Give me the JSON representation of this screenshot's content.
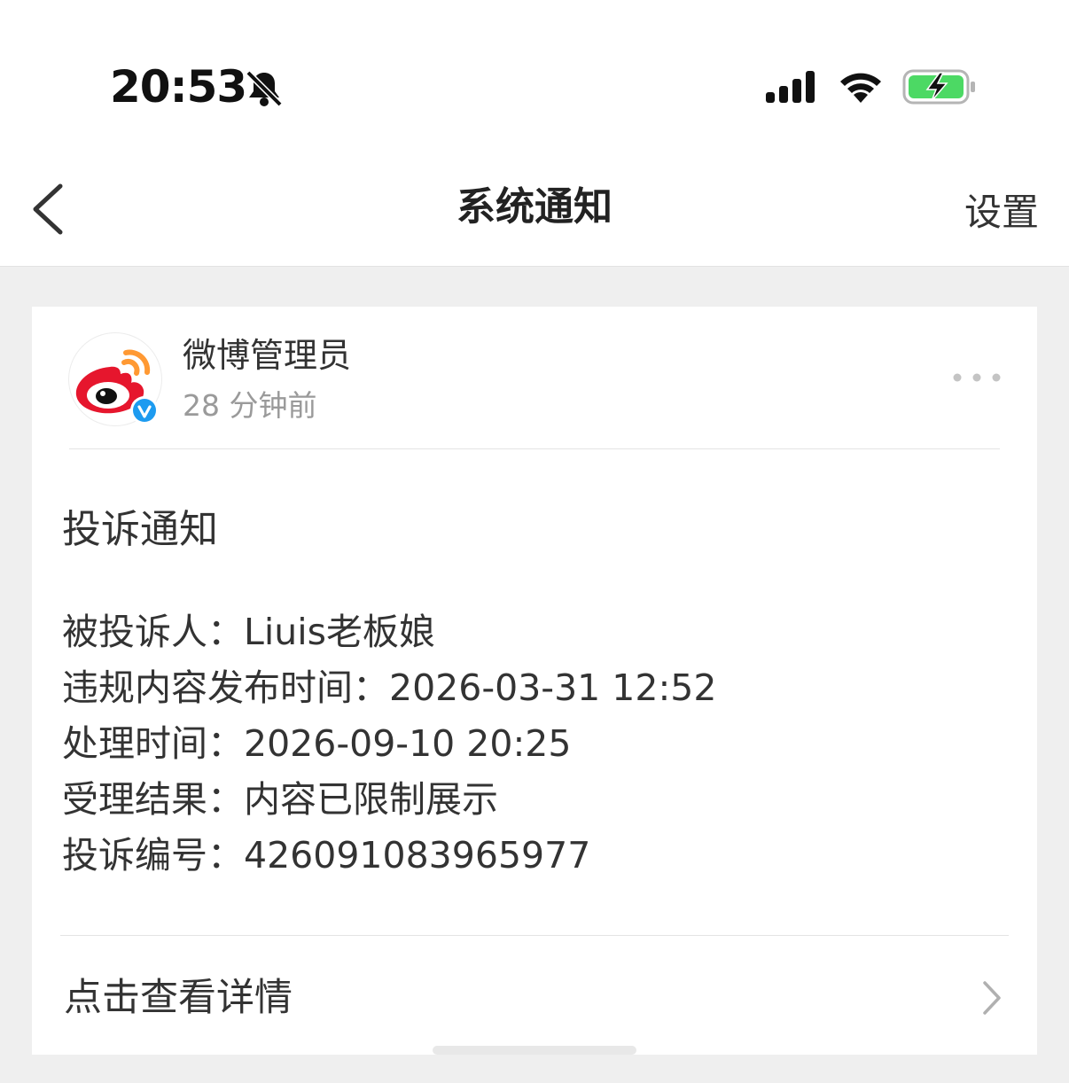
{
  "status_bar": {
    "time": "20:53",
    "icons": [
      "bell-muted-icon",
      "signal-icon",
      "wifi-icon",
      "battery-charging-icon"
    ],
    "battery_color": "#4cd964"
  },
  "nav": {
    "back_icon": "chevron-left-icon",
    "title": "系统通知",
    "right_label": "设置"
  },
  "card": {
    "sender": "微博管理员",
    "time_ago": "28 分钟前",
    "avatar_icon": "weibo-logo-icon",
    "verified_icon": "verified-badge-icon",
    "verified_color": "#1d9bf0",
    "more_icon": "more-dots-icon",
    "title": "投诉通知",
    "fields": [
      {
        "label": "被投诉人：",
        "value": "Liuis老板娘"
      },
      {
        "label": "违规内容发布时间：",
        "value": "2026-03-31 12:52"
      },
      {
        "label": "处理时间：",
        "value": "2026-09-10 20:25"
      },
      {
        "label": "受理结果：",
        "value": "内容已限制展示"
      },
      {
        "label": "投诉编号：",
        "value": "4260910839659​77"
      }
    ],
    "detail_link": "点击查看详情",
    "detail_icon": "chevron-right-icon"
  },
  "colors": {
    "accent_red": "#e6162d",
    "accent_orange": "#ff9933",
    "background": "#efefef"
  }
}
